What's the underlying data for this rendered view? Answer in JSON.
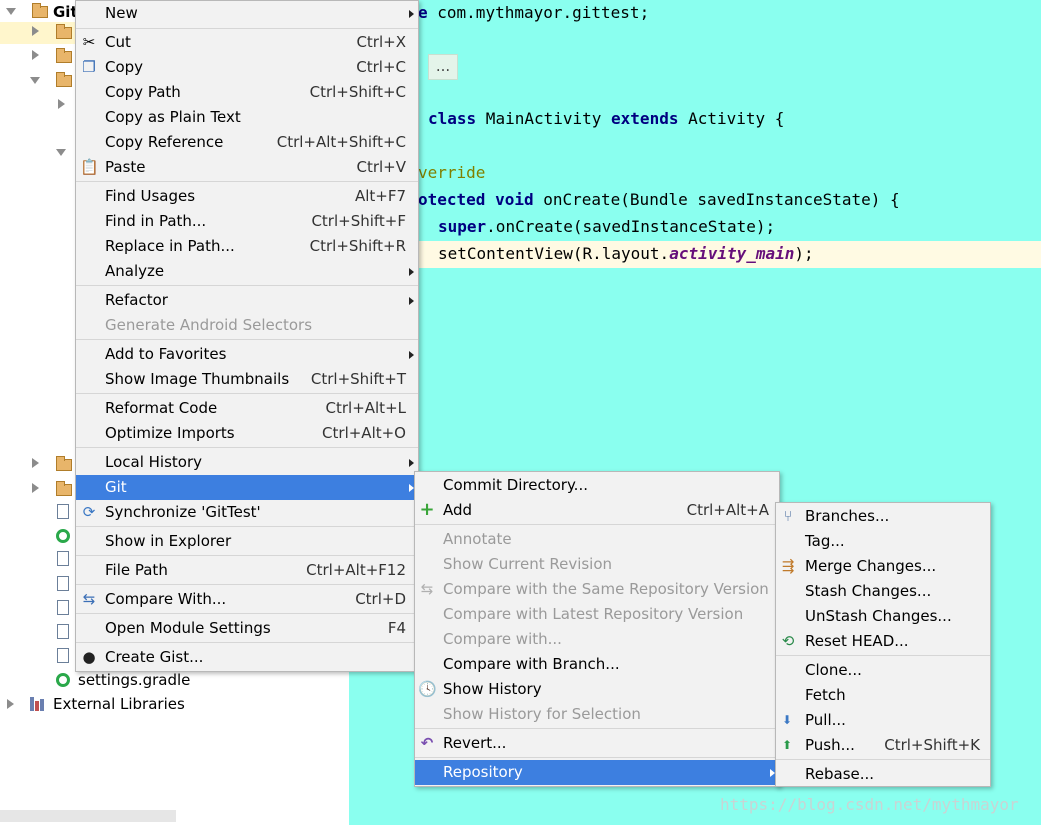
{
  "tree": {
    "root_label": "Git",
    "settings_file": "settings.gradle",
    "external_libraries": "External Libraries"
  },
  "code": {
    "line1_kw": "e",
    "line1_rest": " com.mythmayor.gittest;",
    "fold": "...",
    "line3_class": "class",
    "line3_name": " MainActivity ",
    "line3_extends": "extends",
    "line3_rest": " Activity {",
    "line4_anno": "verride",
    "line5_kw": "otected void",
    "line5_rest": " onCreate(Bundle savedInstanceState) {",
    "line6_super": "super",
    "line6_rest": ".onCreate(savedInstanceState);",
    "line7_pre": "setContentView(R.layout.",
    "line7_field": "activity_main",
    "line7_post": ");"
  },
  "watermark": "https://blog.csdn.net/mythmayor",
  "context_menu": {
    "items": [
      {
        "label": "New",
        "shortcut": ""
      },
      {
        "label": "Cut",
        "shortcut": "Ctrl+X"
      },
      {
        "label": "Copy",
        "shortcut": "Ctrl+C"
      },
      {
        "label": "Copy Path",
        "shortcut": "Ctrl+Shift+C"
      },
      {
        "label": "Copy as Plain Text",
        "shortcut": ""
      },
      {
        "label": "Copy Reference",
        "shortcut": "Ctrl+Alt+Shift+C"
      },
      {
        "label": "Paste",
        "shortcut": "Ctrl+V"
      },
      {
        "label": "Find Usages",
        "shortcut": "Alt+F7"
      },
      {
        "label": "Find in Path...",
        "shortcut": "Ctrl+Shift+F"
      },
      {
        "label": "Replace in Path...",
        "shortcut": "Ctrl+Shift+R"
      },
      {
        "label": "Analyze",
        "shortcut": ""
      },
      {
        "label": "Refactor",
        "shortcut": ""
      },
      {
        "label": "Generate Android Selectors",
        "shortcut": ""
      },
      {
        "label": "Add to Favorites",
        "shortcut": ""
      },
      {
        "label": "Show Image Thumbnails",
        "shortcut": "Ctrl+Shift+T"
      },
      {
        "label": "Reformat Code",
        "shortcut": "Ctrl+Alt+L"
      },
      {
        "label": "Optimize Imports",
        "shortcut": "Ctrl+Alt+O"
      },
      {
        "label": "Local History",
        "shortcut": ""
      },
      {
        "label": "Git",
        "shortcut": ""
      },
      {
        "label": "Synchronize 'GitTest'",
        "shortcut": ""
      },
      {
        "label": "Show in Explorer",
        "shortcut": ""
      },
      {
        "label": "File Path",
        "shortcut": "Ctrl+Alt+F12"
      },
      {
        "label": "Compare With...",
        "shortcut": "Ctrl+D"
      },
      {
        "label": "Open Module Settings",
        "shortcut": "F4"
      },
      {
        "label": "Create Gist...",
        "shortcut": ""
      }
    ]
  },
  "git_menu": {
    "items": [
      {
        "label": "Commit Directory...",
        "shortcut": ""
      },
      {
        "label": "Add",
        "shortcut": "Ctrl+Alt+A"
      },
      {
        "label": "Annotate",
        "shortcut": ""
      },
      {
        "label": "Show Current Revision",
        "shortcut": ""
      },
      {
        "label": "Compare with the Same Repository Version",
        "shortcut": ""
      },
      {
        "label": "Compare with Latest Repository Version",
        "shortcut": ""
      },
      {
        "label": "Compare with...",
        "shortcut": ""
      },
      {
        "label": "Compare with Branch...",
        "shortcut": ""
      },
      {
        "label": "Show History",
        "shortcut": ""
      },
      {
        "label": "Show History for Selection",
        "shortcut": ""
      },
      {
        "label": "Revert...",
        "shortcut": ""
      },
      {
        "label": "Repository",
        "shortcut": ""
      }
    ]
  },
  "repo_menu": {
    "items": [
      {
        "label": "Branches...",
        "shortcut": ""
      },
      {
        "label": "Tag...",
        "shortcut": ""
      },
      {
        "label": "Merge Changes...",
        "shortcut": ""
      },
      {
        "label": "Stash Changes...",
        "shortcut": ""
      },
      {
        "label": "UnStash Changes...",
        "shortcut": ""
      },
      {
        "label": "Reset HEAD...",
        "shortcut": ""
      },
      {
        "label": "Clone...",
        "shortcut": ""
      },
      {
        "label": "Fetch",
        "shortcut": ""
      },
      {
        "label": "Pull...",
        "shortcut": ""
      },
      {
        "label": "Push...",
        "shortcut": "Ctrl+Shift+K"
      },
      {
        "label": "Rebase...",
        "shortcut": ""
      }
    ]
  },
  "colors": {
    "editor_bg": "#8affef",
    "selection": "#3d7fe0",
    "menu_bg": "#f2f2f2"
  }
}
